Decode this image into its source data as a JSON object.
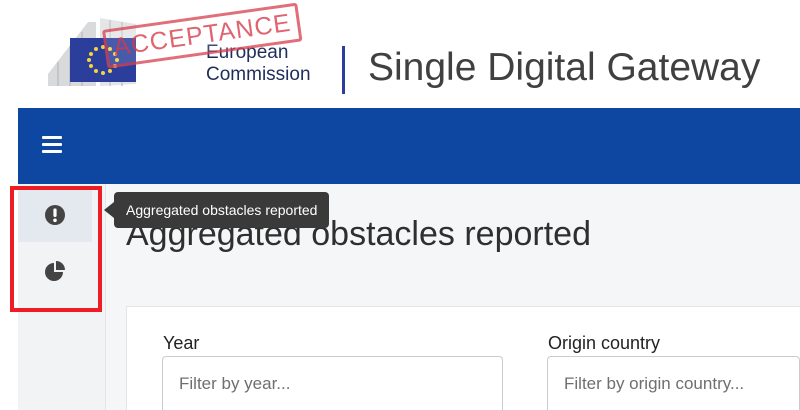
{
  "header": {
    "logo_stamp": "ACCEPTANCE",
    "logo_line1": "European",
    "logo_line2": "Commission",
    "site_title": "Single Digital Gateway"
  },
  "topbar": {
    "menu_icon": "hamburger-menu-icon",
    "color": "#0e47a1"
  },
  "sidebar": {
    "items": [
      {
        "icon": "exclamation-circle-icon",
        "active": true
      },
      {
        "icon": "pie-chart-icon",
        "active": false
      }
    ],
    "highlight_color": "#ee1c25"
  },
  "tooltip": {
    "text": "Aggregated obstacles reported"
  },
  "main": {
    "page_title": "Aggregated obstacles reported",
    "filters": [
      {
        "label": "Year",
        "placeholder": "Filter by year..."
      },
      {
        "label": "Origin country",
        "placeholder": "Filter by origin country..."
      }
    ]
  }
}
